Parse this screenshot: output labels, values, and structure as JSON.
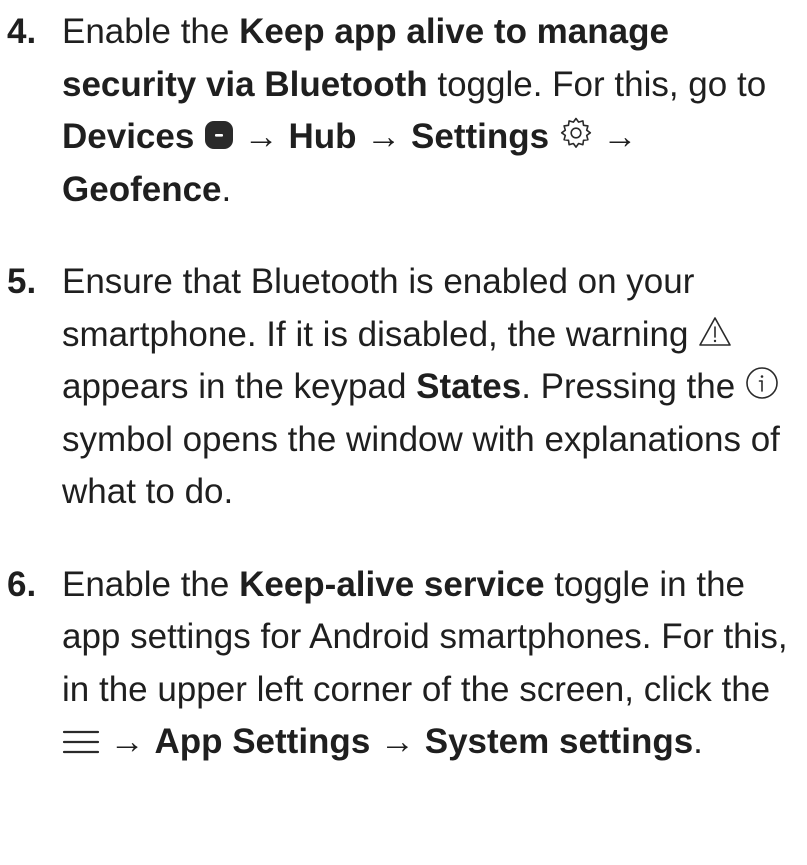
{
  "steps": [
    {
      "number": "4.",
      "t1": "Enable the ",
      "b1": "Keep app alive to manage security via Bluetooth",
      "t2": " toggle. For this, go to ",
      "b2": "Devices",
      "icon1": "devices-tab-icon",
      "t3": " → ",
      "b3": "Hub",
      "t4": " → ",
      "b4": "Settings",
      "icon2": "gear-icon",
      "t5": " → ",
      "b5": "Geofence",
      "t6": "."
    },
    {
      "number": "5.",
      "t1": "Ensure that Bluetooth is enabled on your smartphone. If it is disabled, the warning ",
      "icon1": "warning-icon",
      "t2": " appears in the keypad ",
      "b1": "States",
      "t3": ". Pressing the ",
      "icon2": "info-icon",
      "t4": " symbol opens the window with explanations of what to do."
    },
    {
      "number": "6.",
      "t1": "Enable the ",
      "b1": "Keep-alive service",
      "t2": " toggle in the app settings for Android smartphones. For this, in the upper left corner of the screen, click the ",
      "icon1": "hamburger-menu-icon",
      "t3": " → ",
      "b2": "App Settings",
      "t4": " → ",
      "b3": "System settings",
      "t5": "."
    }
  ],
  "colors": {
    "text": "#1f1f1f",
    "icon": "#2a2a2a"
  }
}
